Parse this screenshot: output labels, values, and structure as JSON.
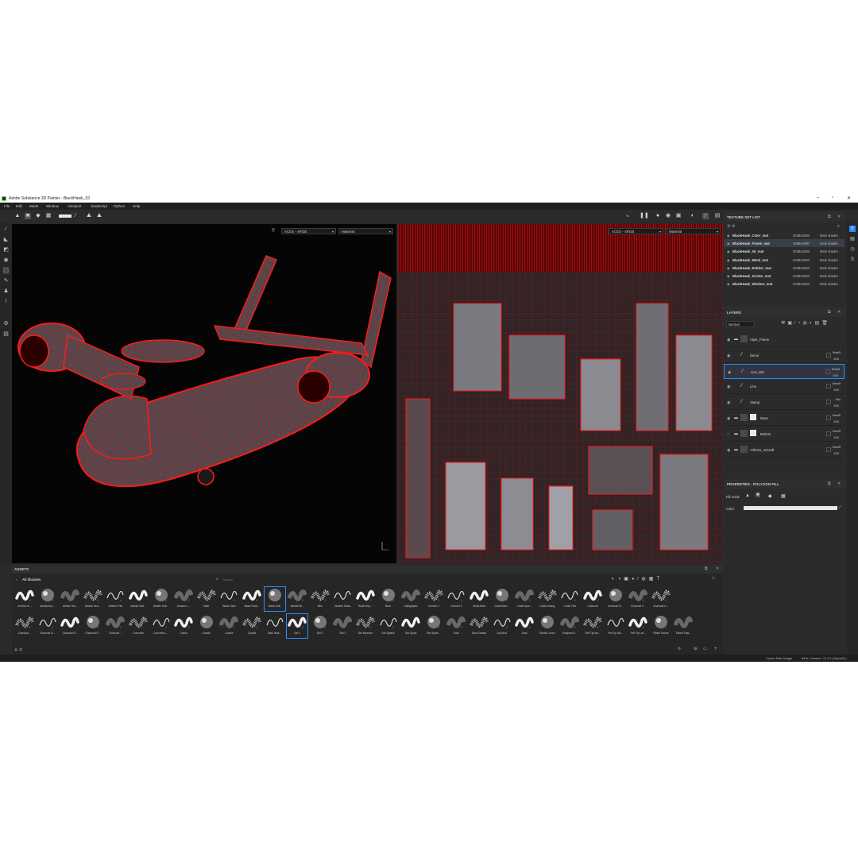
{
  "window": {
    "title": "Adobe Substance 3D Painter - BlackHawk_03"
  },
  "menu": [
    "File",
    "Edit",
    "Mode",
    "Window",
    "Viewport",
    "JavaScript",
    "Python",
    "Help"
  ],
  "viewport3d": {
    "colorspace": "ACES - sRGB",
    "channel": "Material"
  },
  "viewport2d": {
    "colorspace": "ACES - sRGB",
    "channel": "Material"
  },
  "texture_sets": {
    "title": "TEXTURE SET LIST",
    "items": [
      {
        "name": "BlackHawk_Color_mat",
        "res": "2048x2048",
        "shader": "Main shader"
      },
      {
        "name": "BlackHawk_Frame_mat",
        "res": "4096x4096",
        "shader": "Main shader"
      },
      {
        "name": "BlackHawk_Int_mat",
        "res": "2048x2048",
        "shader": "Main shader"
      },
      {
        "name": "BlackHawk_Metal_mat",
        "res": "2048x2048",
        "shader": "Main shader"
      },
      {
        "name": "BlackHawk_Rubber_mat",
        "res": "2048x2048",
        "shader": "Main shader"
      },
      {
        "name": "BlackHawk_Screen_mat",
        "res": "2048x2048",
        "shader": "Main shader"
      },
      {
        "name": "BlackHawk_Window_mat",
        "res": "2048x2048",
        "shader": "Main shader"
      }
    ]
  },
  "layers": {
    "title": "LAYERS",
    "blend_mode": "Normal",
    "items": [
      {
        "name": "Viper_Frame",
        "blend": "",
        "opacity": ""
      },
      {
        "name": "Decal",
        "blend": "NrmB",
        "opacity": "100"
      },
      {
        "name": "Line_Dirt",
        "blend": "NrmB",
        "opacity": "100"
      },
      {
        "name": "Line",
        "blend": "NrmB",
        "opacity": "100"
      },
      {
        "name": "Stamp",
        "blend": "Rtu",
        "opacity": "100"
      },
      {
        "name": "Nose",
        "blend": "NrmB",
        "opacity": "100"
      },
      {
        "name": "Bottom",
        "blend": "NrmB",
        "opacity": "100"
      },
      {
        "name": "Airforce_Aircraft",
        "blend": "NrmB",
        "opacity": "100"
      }
    ]
  },
  "properties": {
    "title": "PROPERTIES - POLYGON FILL",
    "fill_mode_label": "Fill mode",
    "color_label": "Color"
  },
  "assets": {
    "title": "ASSETS",
    "library": "All libraries",
    "search_placeholder": "Search",
    "row1": [
      "Archive In...",
      "Artistic Bru...",
      "Artistic Hai...",
      "Artistic Hea...",
      "Artistic Print",
      "Artistic Soft...",
      "Artistic Soft...",
      "Autumn L...",
      "Bark",
      "Basic Hard",
      "Basic Hard...",
      "Basic Soft",
      "Barnett Bl...",
      "Blur",
      "Broken Glass",
      "Bullet Imp...",
      "Burn",
      "Calligraphic",
      "Cement 1",
      "Cement 2",
      "Chalk Bold",
      "Chalk Bum...",
      "Chalk Spre...",
      "Chalk Strong",
      "Chalk Thin",
      "Charcoal",
      "Charcoal Fi...",
      "Charcoal F...",
      "Charcoal Li..."
    ],
    "row2": [
      "Charcoal ...",
      "Charcoal N...",
      "Charcoal R...",
      "Charcoal S...",
      "Charcoal ...",
      "Concrete",
      "Concrete L...",
      "Cotton",
      "Cracks",
      "Cracks",
      "Crystal",
      "Dark Hais...",
      "Dirt 1",
      "Dirt 2",
      "Dirt 3",
      "Dirt Brushed",
      "Dirt Splash",
      "Dirt Spots",
      "Dirt Spots...",
      "Dots",
      "Dots Erased",
      "Dry Mud",
      "Dust",
      "Electric Lines",
      "Elephant S...",
      "Felt Tip Ma...",
      "Felt Tip Ma...",
      "Felt Tip Lar...",
      "Fibers Dense",
      "Fibers Fast..."
    ]
  },
  "status": {
    "cache": "Cache Disk Usage",
    "version": "64% | Version: 11.0.2 (OpenGL)"
  },
  "colors": {
    "accent": "#2a8cff",
    "wire": "#e00000",
    "bg": "#2a2a2a"
  }
}
